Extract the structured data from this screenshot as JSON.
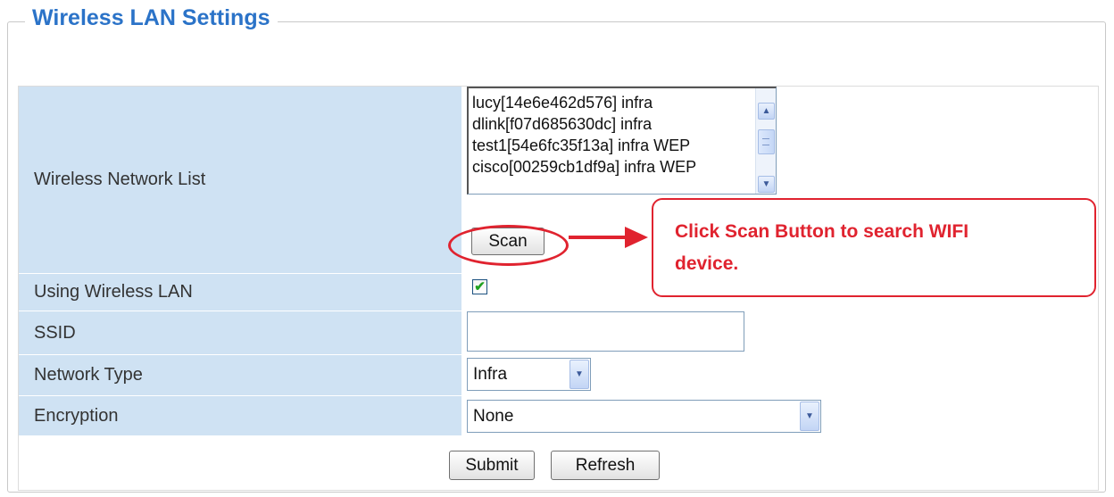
{
  "panel": {
    "title": "Wireless LAN Settings"
  },
  "rows": {
    "network_list": "Wireless Network List",
    "using_wlan": "Using Wireless LAN",
    "ssid": "SSID",
    "network_type": "Network Type",
    "encryption": "Encryption"
  },
  "network_list": {
    "items": [
      "lucy[14e6e462d576] infra",
      "dlink[f07d685630dc] infra",
      "test1[54e6fc35f13a] infra WEP",
      "cisco[00259cb1df9a] infra WEP"
    ],
    "scan_label": "Scan"
  },
  "using_wlan": {
    "checked": true,
    "check_glyph": "✔"
  },
  "ssid": {
    "value": ""
  },
  "network_type": {
    "selected": "Infra"
  },
  "encryption": {
    "selected": "None"
  },
  "actions": {
    "submit_label": "Submit",
    "refresh_label": "Refresh"
  },
  "annotation": {
    "line1": "Click Scan Button to search WIFI",
    "line2": "device.",
    "color": "#e0232f"
  },
  "colors": {
    "title": "#2b73c8",
    "label_bg": "#cfe2f3"
  }
}
